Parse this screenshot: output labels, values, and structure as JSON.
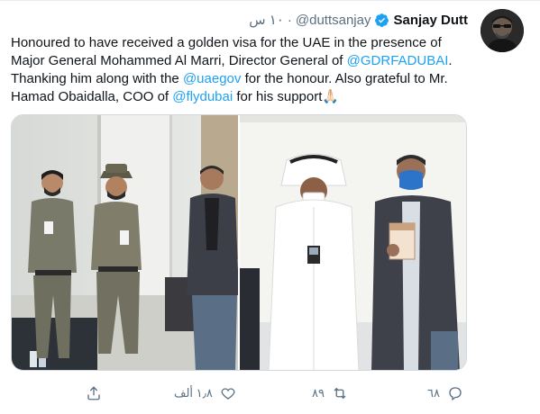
{
  "tweet": {
    "display_name": "Sanjay Dutt",
    "handle": "@duttsanjay",
    "separator": "·",
    "time": "١٠ س",
    "text": {
      "p1": "Honoured to have received a golden visa for the UAE in the presence of Major General Mohammed Al Marri, Director General of ",
      "m1": "@GDRFADUBAI",
      "p2": ". Thanking him along with the ",
      "m2": "@uaegov",
      "p3": " for the honour. Also grateful to Mr. Hamad Obaidalla, COO of ",
      "m3": "@flydubai",
      "p4": " for his support🙏🏻"
    },
    "media": {
      "left_photo": "uniformed-officers-with-sanjay-dutt",
      "right_photo": "sanjay-dutt-holding-passport-with-official"
    },
    "actions": {
      "share_icon": "share-icon",
      "like_icon": "heart-icon",
      "like_count": "١٫٨ ألف",
      "retweet_icon": "retweet-icon",
      "retweet_count": "٨٩",
      "reply_icon": "reply-icon",
      "reply_count": "٦٨"
    },
    "colors": {
      "accent": "#1da1f2",
      "muted": "#5b7083",
      "verified": "#1da1f2"
    }
  }
}
